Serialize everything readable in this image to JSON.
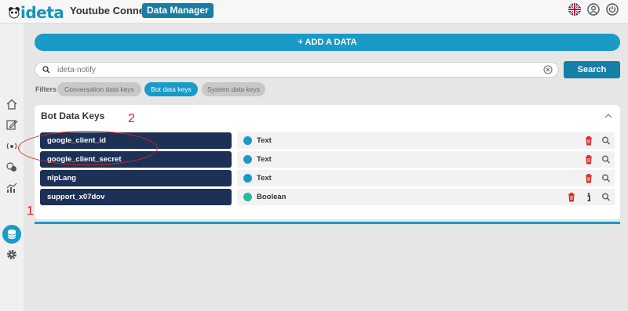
{
  "header": {
    "logo_text": "ideta",
    "bot_name": "Youtube Connect",
    "page_title": "Data Manager",
    "icons": [
      "uk-flag-icon",
      "user-account-icon",
      "power-icon"
    ]
  },
  "sidebar": {
    "items": [
      {
        "icon": "home-icon"
      },
      {
        "icon": "edit-icon"
      },
      {
        "icon": "broadcast-icon"
      },
      {
        "icon": "conversations-icon"
      },
      {
        "icon": "analytics-icon"
      },
      {
        "icon": "database-icon",
        "active": true
      },
      {
        "icon": "settings-icon"
      }
    ]
  },
  "toolbar": {
    "add_label": "+ ADD A DATA",
    "search_placeholder": "ideta-notify",
    "search_label": "Search"
  },
  "filters": {
    "label": "Filters",
    "options": [
      "Conversation data keys",
      "Bot data keys",
      "System data keys"
    ],
    "active": "Bot data keys"
  },
  "panel": {
    "title": "Bot Data Keys",
    "rows": [
      {
        "key": "google_client_id",
        "type": "Text",
        "type_color": "#1a9ac6"
      },
      {
        "key": "google_client_secret",
        "type": "Text",
        "type_color": "#1a9ac6"
      },
      {
        "key": "nlpLang",
        "type": "Text",
        "type_color": "#1a9ac6"
      },
      {
        "key": "support_x07dov",
        "type": "Boolean",
        "type_color": "#2bb89b"
      }
    ]
  },
  "annotations": {
    "label_1": "1",
    "label_2": "2"
  },
  "colors": {
    "accent": "#1a9ac6",
    "navy": "#1d3157",
    "delete": "#d9302c"
  }
}
